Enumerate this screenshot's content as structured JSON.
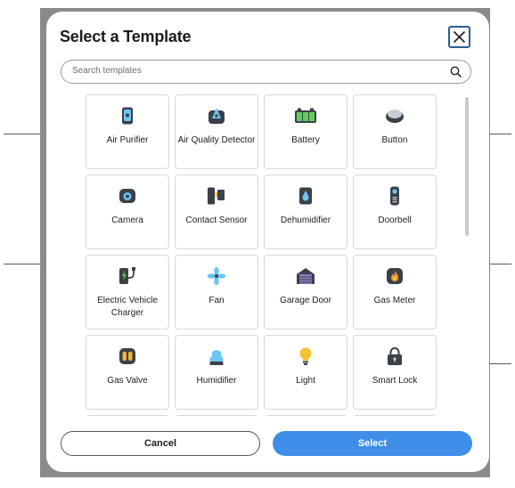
{
  "dialog": {
    "title": "Select a Template",
    "search_placeholder": "Search templates",
    "cancel_label": "Cancel",
    "select_label": "Select"
  },
  "templates": [
    {
      "label": "Air Purifier",
      "icon": "air-purifier-icon"
    },
    {
      "label": "Air Quality Detector",
      "icon": "air-quality-icon"
    },
    {
      "label": "Battery",
      "icon": "battery-icon"
    },
    {
      "label": "Button",
      "icon": "button-icon"
    },
    {
      "label": "Camera",
      "icon": "camera-icon"
    },
    {
      "label": "Contact Sensor",
      "icon": "contact-sensor-icon"
    },
    {
      "label": "Dehumidifier",
      "icon": "dehumidifier-icon"
    },
    {
      "label": "Doorbell",
      "icon": "doorbell-icon"
    },
    {
      "label": "Electric Vehicle Charger",
      "icon": "ev-charger-icon"
    },
    {
      "label": "Fan",
      "icon": "fan-icon"
    },
    {
      "label": "Garage Door",
      "icon": "garage-door-icon"
    },
    {
      "label": "Gas Meter",
      "icon": "gas-meter-icon"
    },
    {
      "label": "Gas Valve",
      "icon": "gas-valve-icon"
    },
    {
      "label": "Humidifier",
      "icon": "humidifier-icon"
    },
    {
      "label": "Light",
      "icon": "light-bulb-icon"
    },
    {
      "label": "Smart Lock",
      "icon": "lock-icon"
    }
  ],
  "colors": {
    "accent": "#3f8ee8",
    "close_border": "#2a5f94"
  }
}
